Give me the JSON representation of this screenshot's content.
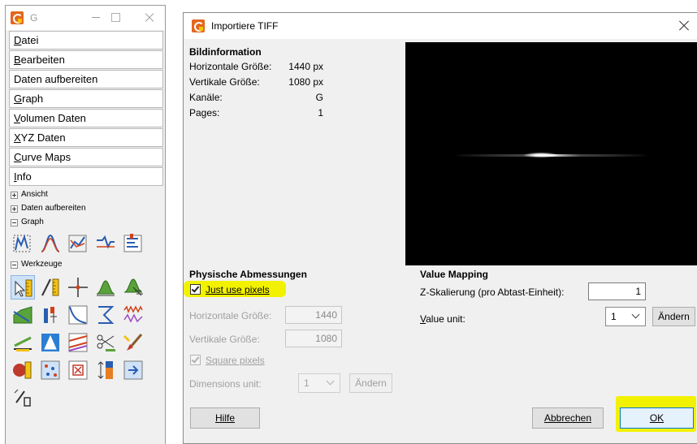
{
  "main_window": {
    "title": "G",
    "menu": [
      {
        "label": "Datei",
        "key": "D",
        "rest": "atei"
      },
      {
        "label": "Bearbeiten",
        "key": "B",
        "rest": "earbeiten"
      },
      {
        "label": "Daten aufbereiten",
        "key": "",
        "rest": "Daten aufbereiten"
      },
      {
        "label": "Graph",
        "key": "G",
        "rest": "raph"
      },
      {
        "label": "Volumen Daten",
        "key": "V",
        "rest": "olumen Daten"
      },
      {
        "label": "XYZ Daten",
        "key": "X",
        "rest": "YZ Daten"
      },
      {
        "label": "Curve Maps",
        "key": "C",
        "rest": "urve Maps"
      },
      {
        "label": "Info",
        "key": "I",
        "rest": "nfo"
      }
    ],
    "tree": {
      "ansicht": "Ansicht",
      "daten_aufbereiten": "Daten aufbereiten",
      "graph": "Graph",
      "werkzeuge": "Werkzeuge"
    },
    "tool_icon_names": [
      "graph-tool-icons",
      "werkzeuge-tool-icons"
    ]
  },
  "dialog": {
    "title": "Importiere TIFF",
    "bildinformation": {
      "heading": "Bildinformation",
      "rows": [
        {
          "label": "Horizontale Größe:",
          "value": "1440 px"
        },
        {
          "label": "Vertikale Größe:",
          "value": "1080 px"
        },
        {
          "label": "Kanäle:",
          "value": "G"
        },
        {
          "label": "Pages:",
          "value": "1"
        }
      ]
    },
    "physische": {
      "heading": "Physische Abmessungen",
      "just_use_pixels": "Just use pixels",
      "just_use_pixels_checked": true,
      "horizontal_label": "Horizontale Größe:",
      "horizontal_value": "1440",
      "vertical_label": "Vertikale Größe:",
      "vertical_value": "1080",
      "square_pixels": "Square pixels",
      "square_pixels_checked": true,
      "dimensions_unit_label": "Dimensions unit:",
      "dimensions_unit_value": "1",
      "aendern": "Ändern"
    },
    "value_mapping": {
      "heading": "Value Mapping",
      "z_label": "Z-Skalierung (pro Abtast-Einheit):",
      "z_value": "1",
      "value_unit_label": "Value unit:",
      "value_unit_value": "1",
      "aendern": "Ändern"
    },
    "buttons": {
      "hilfe": "Hilfe",
      "abbrechen": "Abbrechen",
      "ok": "OK"
    },
    "highlight_color": "#f2f200"
  }
}
